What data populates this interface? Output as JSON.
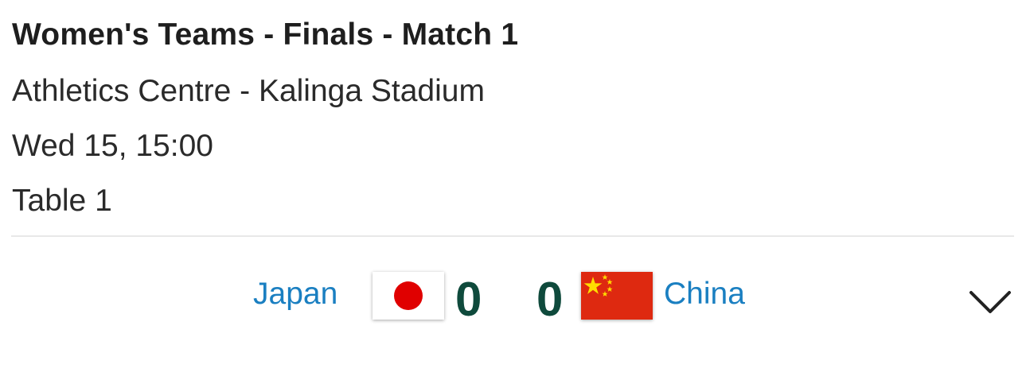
{
  "match": {
    "title": "Women's Teams - Finals - Match 1",
    "venue": "Athletics Centre - Kalinga Stadium",
    "datetime": "Wed 15, 15:00",
    "table": "Table 1"
  },
  "home": {
    "name": "Japan",
    "score": "0",
    "flag_icon": "japan-flag-icon"
  },
  "away": {
    "name": "China",
    "score": "0",
    "flag_icon": "china-flag-icon"
  },
  "colors": {
    "team_link": "#1a7fc1",
    "score": "#0f4a3c",
    "japan_red": "#bc002d",
    "china_red": "#de2910",
    "china_star": "#ffde00"
  },
  "expand_icon": "chevron-down-icon"
}
